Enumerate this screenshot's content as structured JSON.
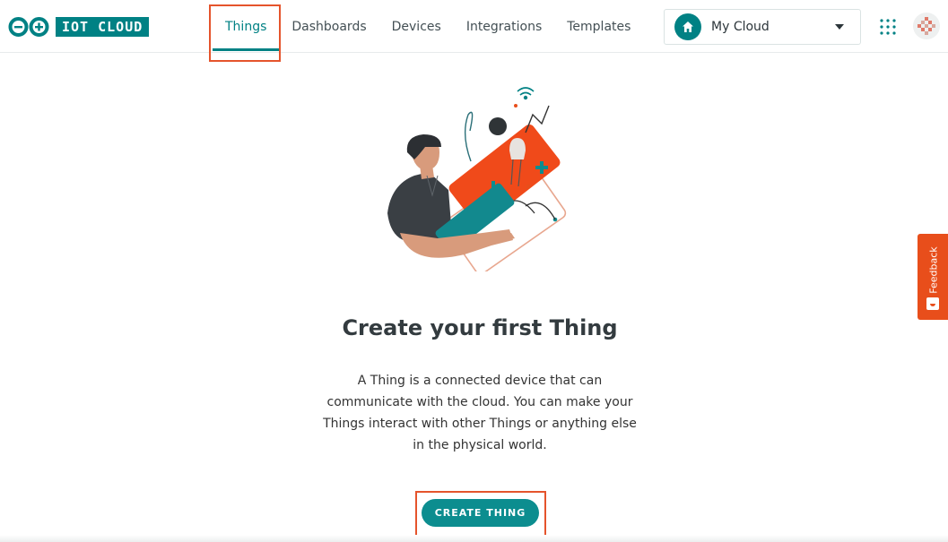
{
  "brand": {
    "logo_text": "IOT CLOUD",
    "accent": "#008184"
  },
  "nav": {
    "items": [
      {
        "label": "Things",
        "active": true
      },
      {
        "label": "Dashboards",
        "active": false
      },
      {
        "label": "Devices",
        "active": false
      },
      {
        "label": "Integrations",
        "active": false
      },
      {
        "label": "Templates",
        "active": false
      }
    ]
  },
  "space_selector": {
    "label": "My Cloud",
    "icon": "home-icon"
  },
  "header_icons": {
    "apps": "apps-grid-icon",
    "avatar": "user-avatar"
  },
  "empty_state": {
    "title": "Create your first Thing",
    "description": "A Thing is a connected device that can communicate with the cloud. You can make your Things interact with other Things or anything else in the physical world.",
    "button_label": "CREATE THING"
  },
  "feedback": {
    "label": "Feedback",
    "color": "#e84e1b"
  },
  "annotation_color": "#e5542c"
}
